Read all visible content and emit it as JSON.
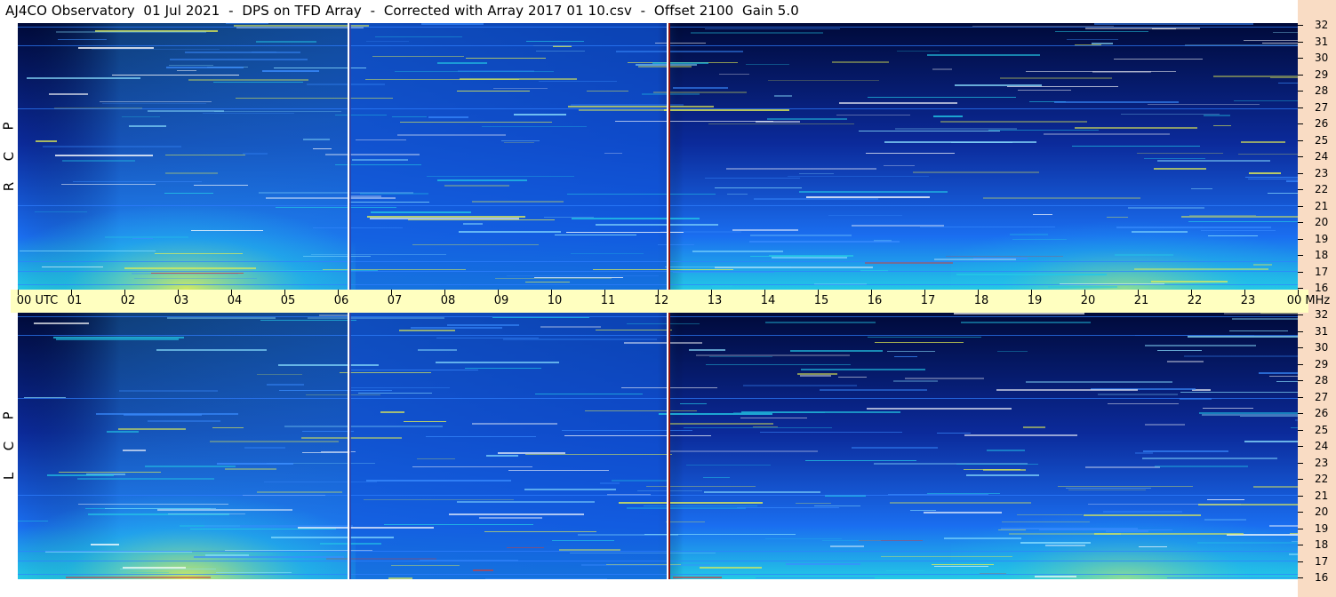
{
  "title": "AJ4CO Observatory  01 Jul 2021  -  DPS on TFD Array  -  Corrected with Array 2017 01 10.csv  -  Offset 2100  Gain 5.0",
  "panels": [
    {
      "label_letters": [
        "P",
        "C",
        "R"
      ]
    },
    {
      "label_letters": [
        "P",
        "C",
        "L"
      ]
    }
  ],
  "freq_axis": {
    "labels": [
      "32",
      "31",
      "30",
      "29",
      "28",
      "27",
      "26",
      "25",
      "24",
      "23",
      "22",
      "21",
      "20",
      "19",
      "18",
      "17",
      "16"
    ]
  },
  "time_axis": {
    "labels": [
      "00 UTC",
      "01",
      "02",
      "03",
      "04",
      "05",
      "06",
      "07",
      "08",
      "09",
      "10",
      "11",
      "12",
      "13",
      "14",
      "15",
      "16",
      "17",
      "18",
      "19",
      "20",
      "21",
      "22",
      "23",
      "00 MHz"
    ]
  },
  "colors": {
    "background": "#ffffff",
    "time_axis_bg": "#ffffc0",
    "freq_axis_bg": "#f9dcc4",
    "spectrogram_dark": "#000a3a",
    "spectrogram_blue": "#0a46e0",
    "spectrogram_cyan": "#23c8e6",
    "spectrogram_yellow": "#e6f050",
    "marker_white": "#ffffff",
    "marker_red": "#8a1010"
  },
  "icons": [
    "spectrogram-image"
  ]
}
